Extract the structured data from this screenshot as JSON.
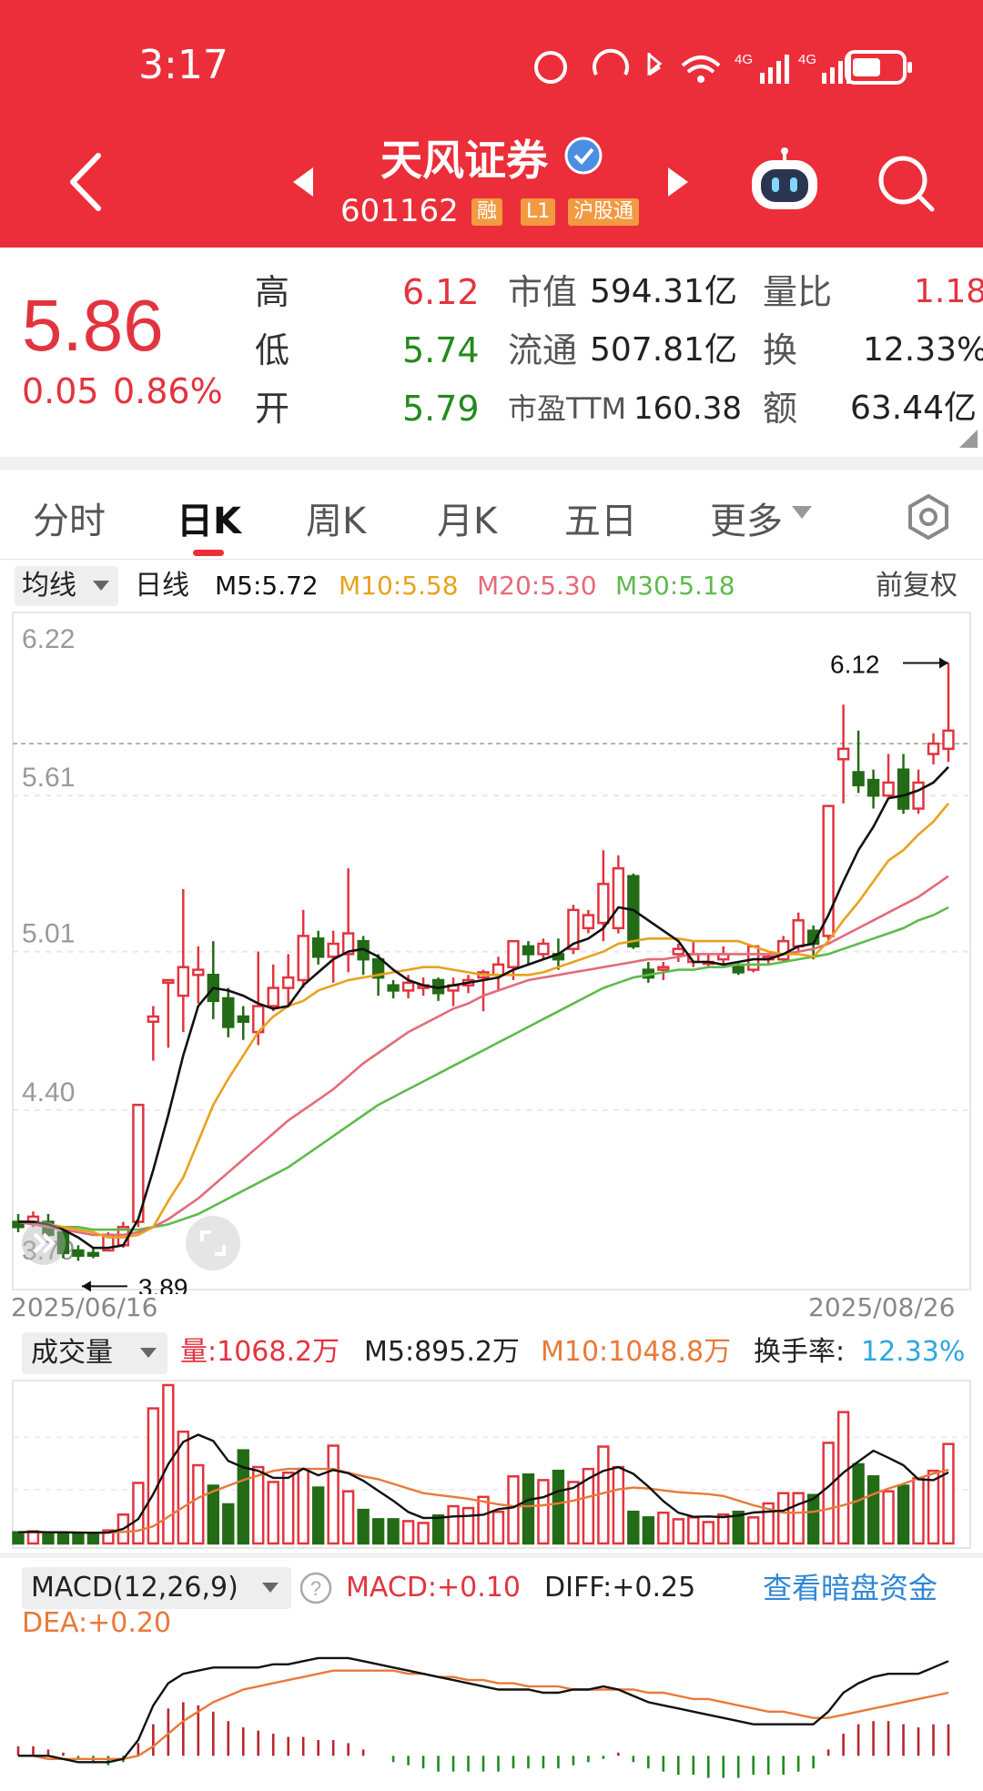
{
  "status_bar": {
    "time": "3:17"
  },
  "header": {
    "title": "天风证券",
    "code": "601162",
    "tags": [
      "融",
      "L1",
      "沪股通"
    ]
  },
  "quote": {
    "price": "5.86",
    "change": "0.05",
    "change_pct": "0.86%",
    "high_label": "高",
    "high": "6.12",
    "low_label": "低",
    "low": "5.74",
    "open_label": "开",
    "open": "5.79",
    "mcap_label": "市值",
    "mcap": "594.31亿",
    "float_label": "流通",
    "float": "507.81亿",
    "pe_label": "市盈TTM",
    "pe": "160.38",
    "vr_label": "量比",
    "vr": "1.18",
    "turnover_label": "换",
    "turnover": "12.33%",
    "amount_label": "额",
    "amount": "63.44亿"
  },
  "tabs": [
    "分时",
    "日K",
    "周K",
    "月K",
    "五日",
    "更多"
  ],
  "active_tab": 1,
  "ma_bar": {
    "selector": "均线",
    "period": "日线",
    "m5": "M5:5.72",
    "m10": "M10:5.58",
    "m20": "M20:5.30",
    "m30": "M30:5.18",
    "adjust": "前复权"
  },
  "colors": {
    "up": "#e2343f",
    "down": "#236b16",
    "m5": "#111111",
    "m10": "#e8a21c",
    "m20": "#e46a7a",
    "m30": "#5dbb4b",
    "accent": "#ec2e3a",
    "link": "#2f86d6",
    "dif": "#111111",
    "dea": "#e8793a"
  },
  "chart_data": {
    "type": "candlestick",
    "price_axis": [
      "6.22",
      "5.61",
      "5.01",
      "4.40",
      "3.79"
    ],
    "price_range": [
      3.79,
      6.22
    ],
    "date_start": "2025/06/16",
    "date_end": "2025/08/26",
    "high_marker": "6.12",
    "low_marker": "3.89",
    "ref_line": 5.81,
    "candles": [
      [
        3.97,
        3.95,
        3.93,
        4.0
      ],
      [
        3.97,
        3.99,
        3.95,
        4.01
      ],
      [
        3.97,
        3.92,
        3.9,
        4.0
      ],
      [
        3.93,
        3.85,
        3.83,
        3.95
      ],
      [
        3.86,
        3.84,
        3.82,
        3.88
      ],
      [
        3.85,
        3.84,
        3.83,
        3.87
      ],
      [
        3.86,
        3.92,
        3.86,
        3.93
      ],
      [
        3.88,
        3.95,
        3.87,
        3.97
      ],
      [
        3.97,
        4.42,
        3.95,
        4.42
      ],
      [
        4.74,
        4.76,
        4.59,
        4.8
      ],
      [
        4.89,
        4.9,
        4.64,
        4.9
      ],
      [
        4.84,
        4.95,
        4.7,
        5.25
      ],
      [
        4.92,
        4.94,
        4.81,
        5.03
      ],
      [
        4.92,
        4.82,
        4.75,
        5.05
      ],
      [
        4.83,
        4.72,
        4.68,
        4.87
      ],
      [
        4.76,
        4.74,
        4.67,
        4.8
      ],
      [
        4.7,
        4.8,
        4.65,
        5.01
      ],
      [
        4.8,
        4.87,
        4.78,
        4.96
      ],
      [
        4.87,
        4.91,
        4.8,
        5.0
      ],
      [
        4.9,
        5.07,
        4.87,
        5.17
      ],
      [
        5.06,
        4.99,
        4.96,
        5.09
      ],
      [
        4.99,
        5.04,
        4.89,
        5.09
      ],
      [
        5.0,
        5.08,
        4.93,
        5.33
      ],
      [
        5.05,
        4.98,
        4.92,
        5.07
      ],
      [
        4.98,
        4.91,
        4.84,
        5.0
      ],
      [
        4.88,
        4.86,
        4.83,
        4.9
      ],
      [
        4.86,
        4.89,
        4.83,
        4.92
      ],
      [
        4.87,
        4.88,
        4.84,
        4.91
      ],
      [
        4.9,
        4.85,
        4.82,
        4.91
      ],
      [
        4.86,
        4.88,
        4.8,
        4.91
      ],
      [
        4.88,
        4.9,
        4.85,
        4.92
      ],
      [
        4.91,
        4.93,
        4.78,
        4.94
      ],
      [
        4.92,
        4.96,
        4.86,
        4.99
      ],
      [
        4.95,
        5.05,
        4.9,
        5.05
      ],
      [
        5.03,
        5.0,
        4.96,
        5.05
      ],
      [
        5.0,
        5.04,
        4.98,
        5.06
      ],
      [
        5.0,
        4.98,
        4.94,
        5.06
      ],
      [
        5.02,
        5.17,
        5.0,
        5.19
      ],
      [
        5.1,
        5.15,
        5.08,
        5.17
      ],
      [
        5.12,
        5.27,
        5.05,
        5.4
      ],
      [
        5.1,
        5.33,
        5.08,
        5.38
      ],
      [
        5.3,
        5.03,
        5.02,
        5.31
      ],
      [
        4.94,
        4.91,
        4.89,
        4.97
      ],
      [
        4.94,
        4.95,
        4.9,
        4.97
      ],
      [
        5.0,
        5.02,
        4.97,
        5.04
      ],
      [
        4.97,
        5.0,
        4.95,
        5.05
      ],
      [
        4.97,
        4.97,
        4.95,
        5.0
      ],
      [
        4.98,
        5.0,
        4.96,
        5.03
      ],
      [
        4.95,
        4.93,
        4.92,
        4.97
      ],
      [
        4.94,
        5.03,
        4.93,
        5.03
      ],
      [
        4.98,
        4.99,
        4.96,
        5.0
      ],
      [
        4.98,
        5.05,
        4.97,
        5.07
      ],
      [
        5.03,
        5.13,
        5.01,
        5.16
      ],
      [
        5.09,
        5.04,
        4.98,
        5.11
      ],
      [
        5.07,
        5.57,
        5.05,
        5.57
      ],
      [
        5.75,
        5.79,
        5.58,
        5.96
      ],
      [
        5.7,
        5.65,
        5.62,
        5.86
      ],
      [
        5.67,
        5.61,
        5.56,
        5.71
      ],
      [
        5.61,
        5.66,
        5.62,
        5.77
      ],
      [
        5.71,
        5.56,
        5.54,
        5.77
      ],
      [
        5.56,
        5.66,
        5.54,
        5.71
      ],
      [
        5.77,
        5.81,
        5.73,
        5.85
      ],
      [
        5.79,
        5.86,
        5.74,
        6.12
      ]
    ],
    "ma5": [
      3.97,
      3.97,
      3.96,
      3.94,
      3.91,
      3.87,
      3.87,
      3.88,
      3.98,
      4.17,
      4.38,
      4.61,
      4.8,
      4.87,
      4.86,
      4.84,
      4.81,
      4.79,
      4.8,
      4.88,
      4.93,
      4.98,
      5.01,
      5.02,
      4.99,
      4.94,
      4.9,
      4.88,
      4.87,
      4.88,
      4.89,
      4.9,
      4.91,
      4.94,
      4.96,
      4.98,
      5.0,
      5.04,
      5.06,
      5.1,
      5.18,
      5.17,
      5.13,
      5.09,
      5.05,
      4.97,
      4.97,
      4.96,
      4.97,
      4.98,
      4.98,
      5.0,
      5.03,
      5.04,
      5.15,
      5.28,
      5.4,
      5.49,
      5.6,
      5.61,
      5.63,
      5.66,
      5.72
    ],
    "ma10": [
      3.97,
      3.97,
      3.96,
      3.95,
      3.94,
      3.93,
      3.91,
      3.91,
      3.92,
      3.95,
      4.05,
      4.14,
      4.28,
      4.42,
      4.52,
      4.61,
      4.7,
      4.76,
      4.8,
      4.82,
      4.86,
      4.88,
      4.9,
      4.91,
      4.92,
      4.93,
      4.94,
      4.95,
      4.95,
      4.94,
      4.93,
      4.92,
      4.92,
      4.92,
      4.92,
      4.93,
      4.95,
      4.97,
      4.99,
      5.01,
      5.04,
      5.05,
      5.06,
      5.06,
      5.06,
      5.05,
      5.05,
      5.05,
      5.05,
      5.03,
      5.01,
      5.0,
      5.0,
      4.99,
      5.05,
      5.13,
      5.2,
      5.28,
      5.36,
      5.4,
      5.46,
      5.51,
      5.58
    ],
    "ma20": [
      3.97,
      3.96,
      3.95,
      3.94,
      3.93,
      3.92,
      3.92,
      3.92,
      3.93,
      3.95,
      3.98,
      4.02,
      4.06,
      4.11,
      4.16,
      4.21,
      4.26,
      4.31,
      4.36,
      4.4,
      4.44,
      4.48,
      4.53,
      4.58,
      4.62,
      4.66,
      4.7,
      4.73,
      4.76,
      4.79,
      4.81,
      4.84,
      4.86,
      4.88,
      4.9,
      4.91,
      4.92,
      4.93,
      4.94,
      4.95,
      4.96,
      4.97,
      4.98,
      4.98,
      4.99,
      5.0,
      5.0,
      5.0,
      5.0,
      5.0,
      5.0,
      5.0,
      5.01,
      5.02,
      5.04,
      5.07,
      5.1,
      5.13,
      5.16,
      5.19,
      5.22,
      5.26,
      5.3
    ],
    "ma30": [
      3.97,
      3.96,
      3.96,
      3.95,
      3.95,
      3.94,
      3.94,
      3.94,
      3.94,
      3.95,
      3.96,
      3.98,
      4.0,
      4.03,
      4.06,
      4.09,
      4.12,
      4.15,
      4.18,
      4.22,
      4.26,
      4.3,
      4.34,
      4.38,
      4.42,
      4.45,
      4.48,
      4.51,
      4.54,
      4.57,
      4.6,
      4.63,
      4.66,
      4.69,
      4.72,
      4.75,
      4.78,
      4.81,
      4.84,
      4.87,
      4.89,
      4.91,
      4.92,
      4.93,
      4.94,
      4.94,
      4.95,
      4.95,
      4.96,
      4.96,
      4.96,
      4.97,
      4.98,
      4.99,
      5.0,
      5.02,
      5.04,
      5.06,
      5.08,
      5.1,
      5.13,
      5.15,
      5.18
    ],
    "volume": {
      "selector": "成交量",
      "vol": "量:1068.2万",
      "m5": "M5:895.2万",
      "m10": "M10:1048.8万",
      "turnover_label": "换手率:",
      "turnover": "12.33%",
      "max": 1700,
      "bars": [
        120,
        130,
        110,
        120,
        100,
        110,
        140,
        310,
        650,
        1450,
        1700,
        1200,
        840,
        620,
        420,
        1000,
        820,
        660,
        760,
        800,
        600,
        1050,
        560,
        360,
        260,
        260,
        240,
        220,
        300,
        400,
        380,
        500,
        340,
        720,
        740,
        680,
        780,
        660,
        800,
        1040,
        820,
        340,
        280,
        330,
        260,
        280,
        230,
        310,
        340,
        280,
        430,
        540,
        540,
        520,
        1080,
        1410,
        850,
        720,
        560,
        620,
        700,
        780,
        1068
      ],
      "ma5": [
        120,
        125,
        120,
        120,
        116,
        114,
        116,
        156,
        262,
        530,
        850,
        1090,
        1168,
        1100,
        886,
        818,
        780,
        704,
        704,
        804,
        732,
        788,
        754,
        674,
        566,
        458,
        338,
        274,
        276,
        290,
        296,
        308,
        368,
        388,
        468,
        496,
        562,
        596,
        696,
        780,
        820,
        748,
        612,
        454,
        330,
        286,
        290,
        282,
        300,
        332,
        342,
        352,
        420,
        480,
        610,
        760,
        880,
        996,
        920,
        840,
        690,
        680,
        763
      ],
      "ma10": [
        120,
        120,
        120,
        120,
        118,
        116,
        117,
        124,
        138,
        185,
        287,
        390,
        490,
        560,
        620,
        680,
        730,
        780,
        800,
        800,
        800,
        800,
        760,
        720,
        690,
        640,
        590,
        540,
        520,
        500,
        480,
        450,
        420,
        400,
        400,
        410,
        430,
        460,
        500,
        540,
        580,
        600,
        590,
        570,
        550,
        540,
        530,
        510,
        460,
        410,
        370,
        330,
        330,
        340,
        370,
        410,
        460,
        530,
        590,
        640,
        700,
        750,
        790
      ]
    },
    "macd": {
      "selector": "MACD(12,26,9)",
      "macd": "MACD:+0.10",
      "diff": "DIFF:+0.25",
      "dea": "DEA:+0.20",
      "link": "查看暗盘资金",
      "range": [
        -0.1,
        0.35
      ],
      "hist": [
        0.03,
        0.03,
        0.02,
        0.01,
        -0.01,
        -0.02,
        -0.03,
        -0.02,
        0.04,
        0.1,
        0.15,
        0.17,
        0.16,
        0.14,
        0.11,
        0.09,
        0.08,
        0.07,
        0.06,
        0.06,
        0.05,
        0.05,
        0.04,
        0.02,
        0.0,
        -0.02,
        -0.03,
        -0.04,
        -0.05,
        -0.05,
        -0.05,
        -0.05,
        -0.05,
        -0.04,
        -0.04,
        -0.04,
        -0.04,
        -0.03,
        -0.02,
        -0.01,
        0.01,
        -0.02,
        -0.04,
        -0.05,
        -0.06,
        -0.06,
        -0.07,
        -0.07,
        -0.07,
        -0.06,
        -0.06,
        -0.06,
        -0.05,
        -0.04,
        0.02,
        0.07,
        0.1,
        0.11,
        0.11,
        0.1,
        0.09,
        0.1,
        0.1
      ],
      "diff_line": [
        0.0,
        0.0,
        0.0,
        -0.01,
        -0.02,
        -0.02,
        -0.02,
        -0.01,
        0.05,
        0.16,
        0.23,
        0.26,
        0.27,
        0.28,
        0.28,
        0.28,
        0.28,
        0.29,
        0.29,
        0.3,
        0.31,
        0.31,
        0.31,
        0.3,
        0.29,
        0.28,
        0.27,
        0.26,
        0.25,
        0.24,
        0.23,
        0.22,
        0.21,
        0.21,
        0.21,
        0.2,
        0.2,
        0.21,
        0.21,
        0.22,
        0.21,
        0.19,
        0.17,
        0.16,
        0.15,
        0.14,
        0.13,
        0.12,
        0.11,
        0.1,
        0.1,
        0.1,
        0.1,
        0.1,
        0.14,
        0.2,
        0.23,
        0.25,
        0.26,
        0.26,
        0.26,
        0.28,
        0.3
      ],
      "dea_line": [
        0.0,
        0.0,
        -0.01,
        -0.01,
        -0.01,
        -0.01,
        -0.01,
        -0.01,
        0.0,
        0.03,
        0.07,
        0.11,
        0.14,
        0.17,
        0.19,
        0.21,
        0.22,
        0.23,
        0.24,
        0.25,
        0.26,
        0.27,
        0.27,
        0.27,
        0.27,
        0.27,
        0.26,
        0.26,
        0.25,
        0.25,
        0.24,
        0.24,
        0.23,
        0.23,
        0.22,
        0.22,
        0.22,
        0.21,
        0.21,
        0.21,
        0.21,
        0.21,
        0.2,
        0.2,
        0.19,
        0.18,
        0.18,
        0.17,
        0.16,
        0.15,
        0.14,
        0.14,
        0.13,
        0.12,
        0.12,
        0.13,
        0.14,
        0.15,
        0.16,
        0.17,
        0.18,
        0.19,
        0.2
      ]
    }
  }
}
